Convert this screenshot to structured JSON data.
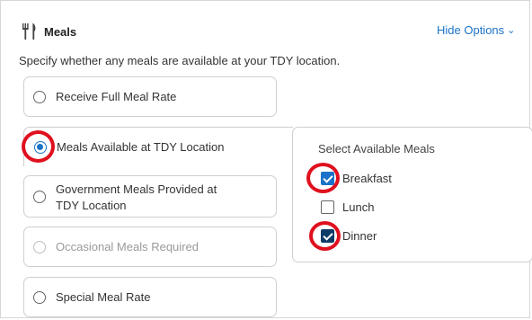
{
  "header": {
    "title": "Meals",
    "hide_options_label": "Hide Options",
    "icon": "fork-knife-icon"
  },
  "description": "Specify whether any meals are available at your TDY location.",
  "options": [
    {
      "label": "Receive Full Meal Rate",
      "selected": false,
      "disabled": false
    },
    {
      "label": "Meals Available at TDY Location",
      "selected": true,
      "disabled": false
    },
    {
      "label_line1": "Government Meals Provided at",
      "label_line2": "TDY Location",
      "selected": false,
      "disabled": false
    },
    {
      "label": "Occasional Meals Required",
      "selected": false,
      "disabled": true
    },
    {
      "label": "Special Meal Rate",
      "selected": false,
      "disabled": false
    }
  ],
  "available_meals": {
    "title": "Select Available Meals",
    "items": [
      {
        "label": "Breakfast",
        "checked": true
      },
      {
        "label": "Lunch",
        "checked": false
      },
      {
        "label": "Dinner",
        "checked": true
      }
    ]
  },
  "colors": {
    "accent": "#1a73c9",
    "highlight": "#e0101e",
    "border": "#cfcfcf"
  }
}
